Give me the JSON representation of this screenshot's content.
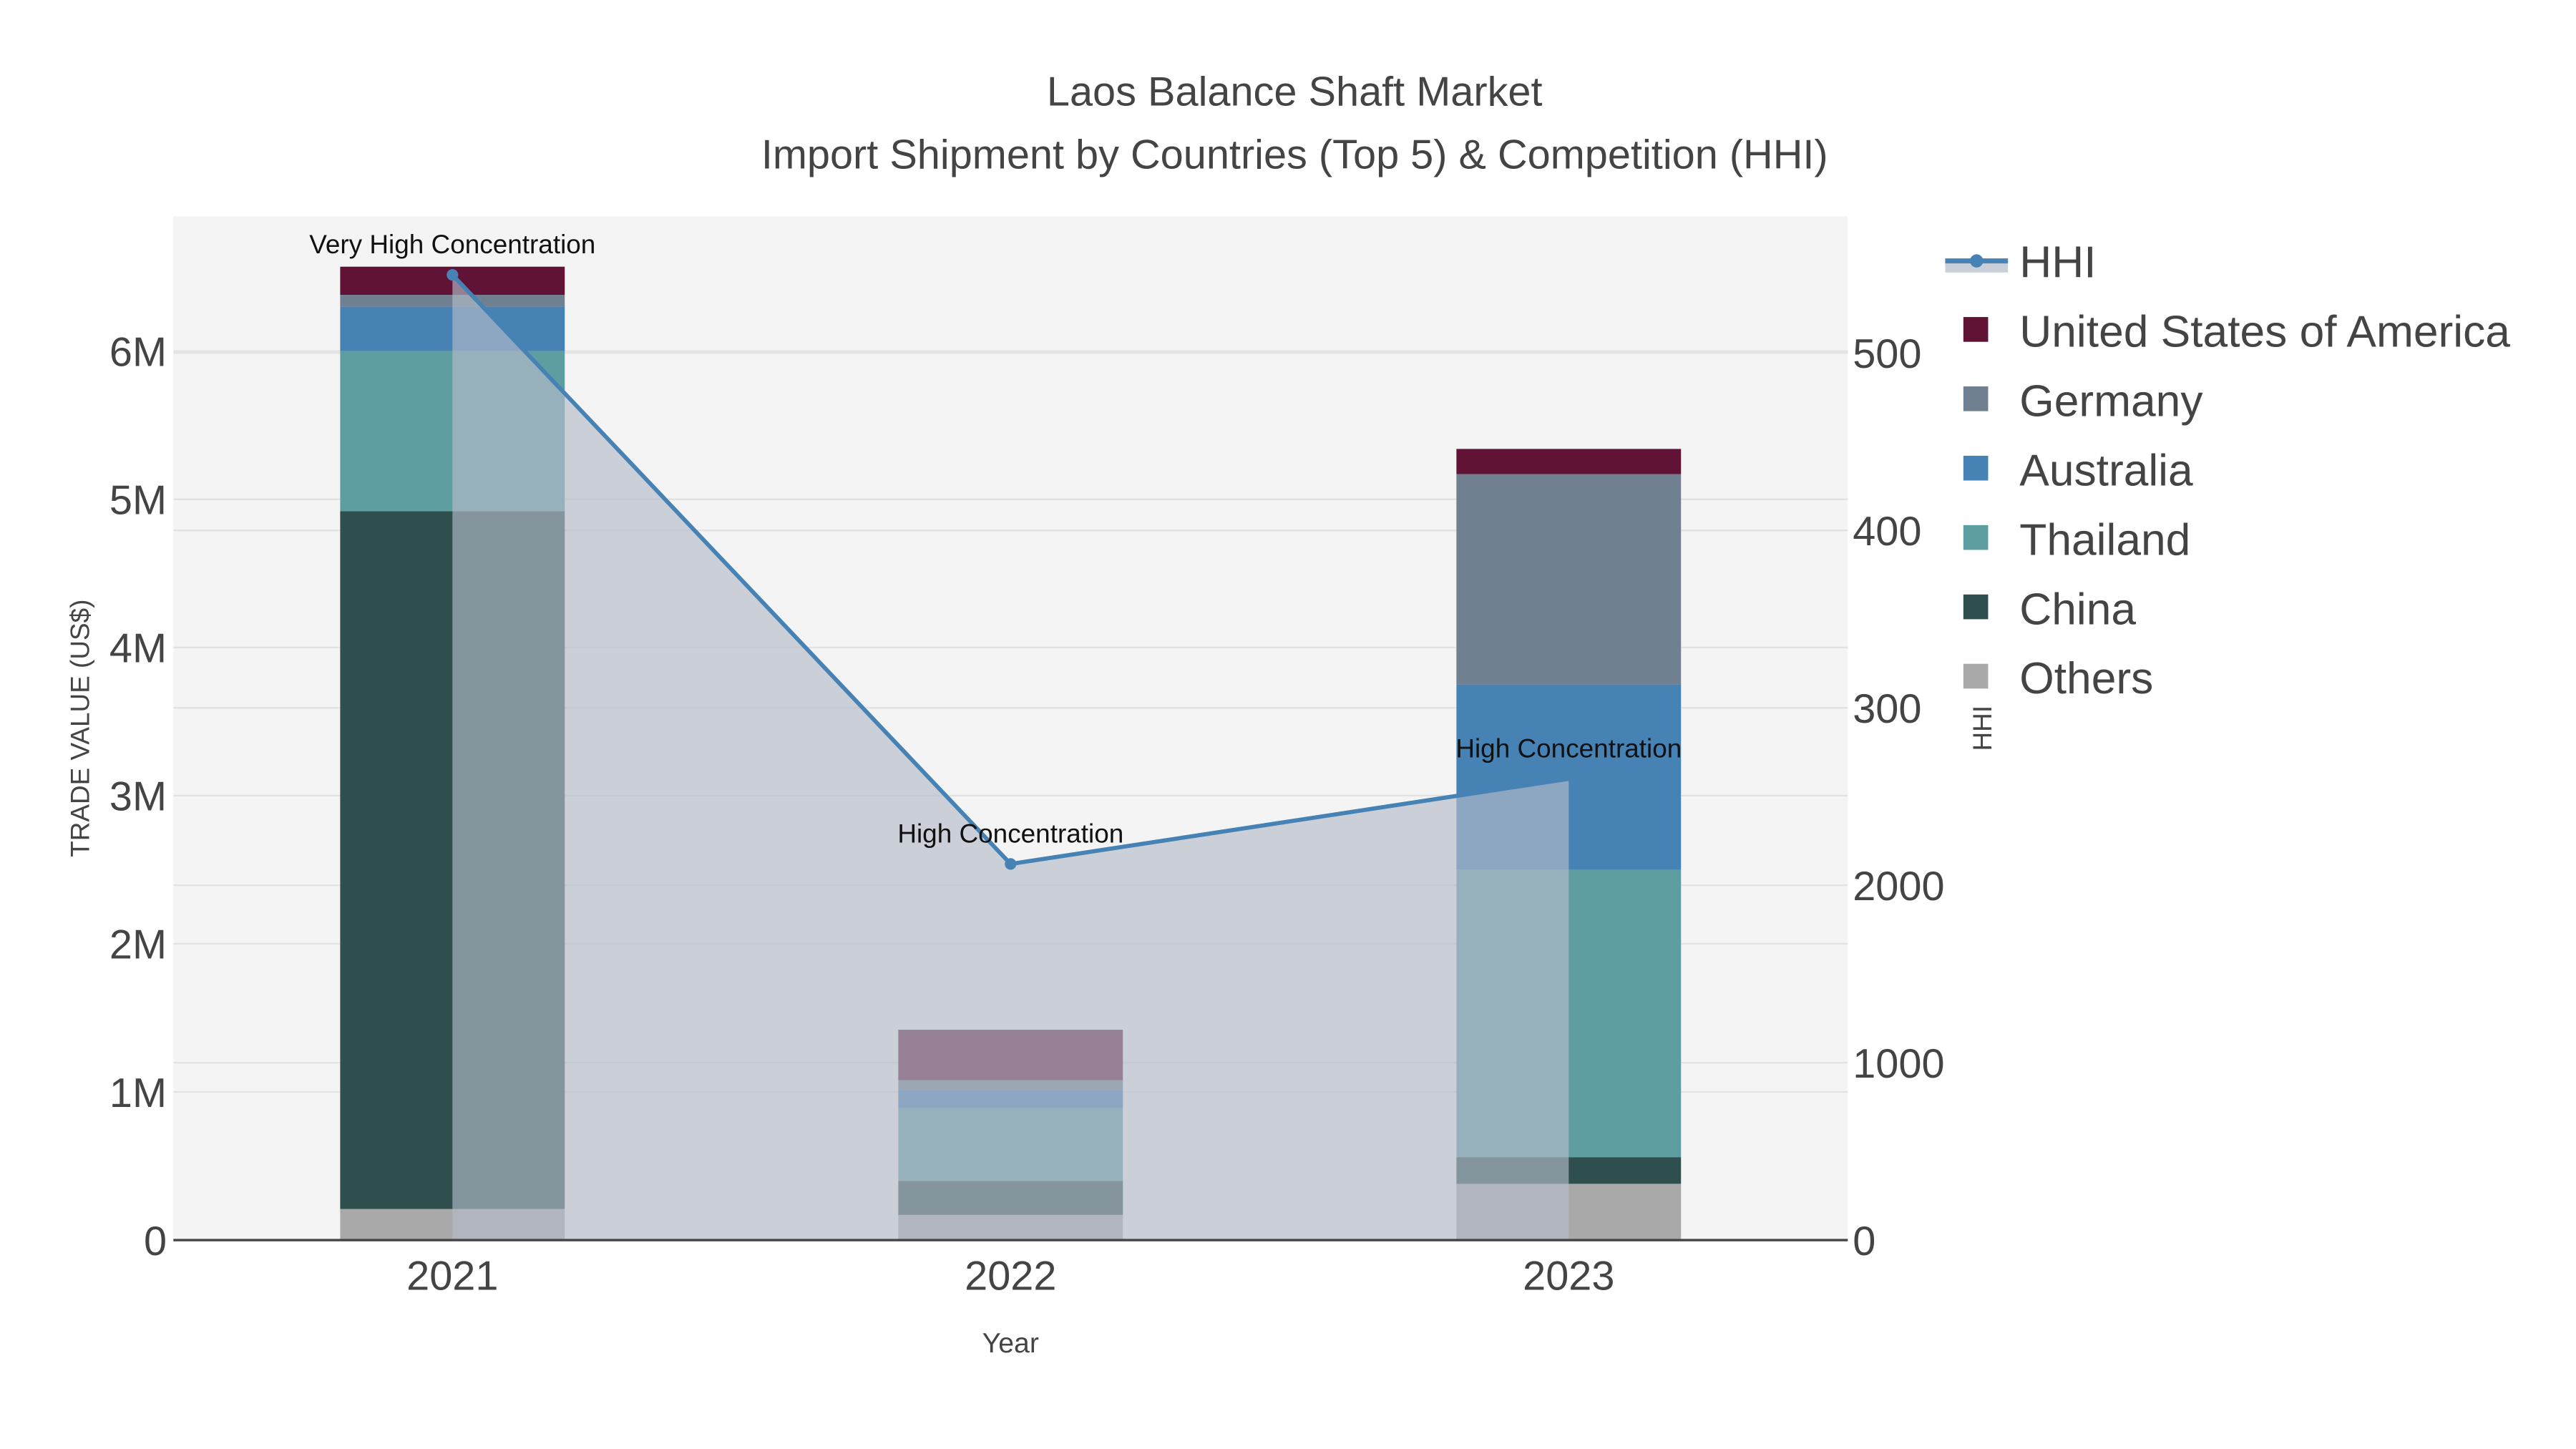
{
  "chart_data": {
    "type": "bar",
    "title": "Laos Balance Shaft Market",
    "subtitle": "Import Shipment by Countries (Top 5) & Competition (HHI)",
    "xlabel": "Year",
    "ylabel": "TRADE VALUE (US$)",
    "y2label": "HHI",
    "categories": [
      "2021",
      "2022",
      "2023"
    ],
    "ylim": [
      0,
      6910000
    ],
    "y2lim": [
      0,
      5770
    ],
    "yticks": [
      0,
      1000000,
      2000000,
      3000000,
      4000000,
      5000000,
      6000000
    ],
    "ytick_labels": [
      "0",
      "1M",
      "2M",
      "3M",
      "4M",
      "5M",
      "6M"
    ],
    "y2ticks": [
      0,
      1000,
      2000,
      3000,
      4000,
      5000
    ],
    "y2tick_labels": [
      "0",
      "1000",
      "2000",
      "300",
      "400",
      "500"
    ],
    "grid": true,
    "legend_position": "right",
    "series": [
      {
        "name": "Others",
        "color": "#a9a9a9",
        "values": [
          210000,
          170000,
          380000
        ]
      },
      {
        "name": "China",
        "color": "#2f4f4f",
        "values": [
          4710000,
          230000,
          180000
        ]
      },
      {
        "name": "Thailand",
        "color": "#5f9ea0",
        "values": [
          1080000,
          490000,
          1940000
        ]
      },
      {
        "name": "Australia",
        "color": "#4682b4",
        "values": [
          300000,
          120000,
          1250000
        ]
      },
      {
        "name": "Germany",
        "color": "#708090",
        "values": [
          80000,
          70000,
          1420000
        ]
      },
      {
        "name": "United States of America",
        "color": "#601334",
        "values": [
          190000,
          340000,
          170000
        ]
      }
    ],
    "hhi": {
      "name": "HHI",
      "color": "#4682b4",
      "values": [
        5440,
        2120,
        2600
      ]
    },
    "annotations": [
      "Very High Concentration",
      "High Concentration",
      "High Concentration"
    ],
    "legend": [
      "HHI",
      "United States of America",
      "Germany",
      "Australia",
      "Thailand",
      "China",
      "Others"
    ]
  }
}
